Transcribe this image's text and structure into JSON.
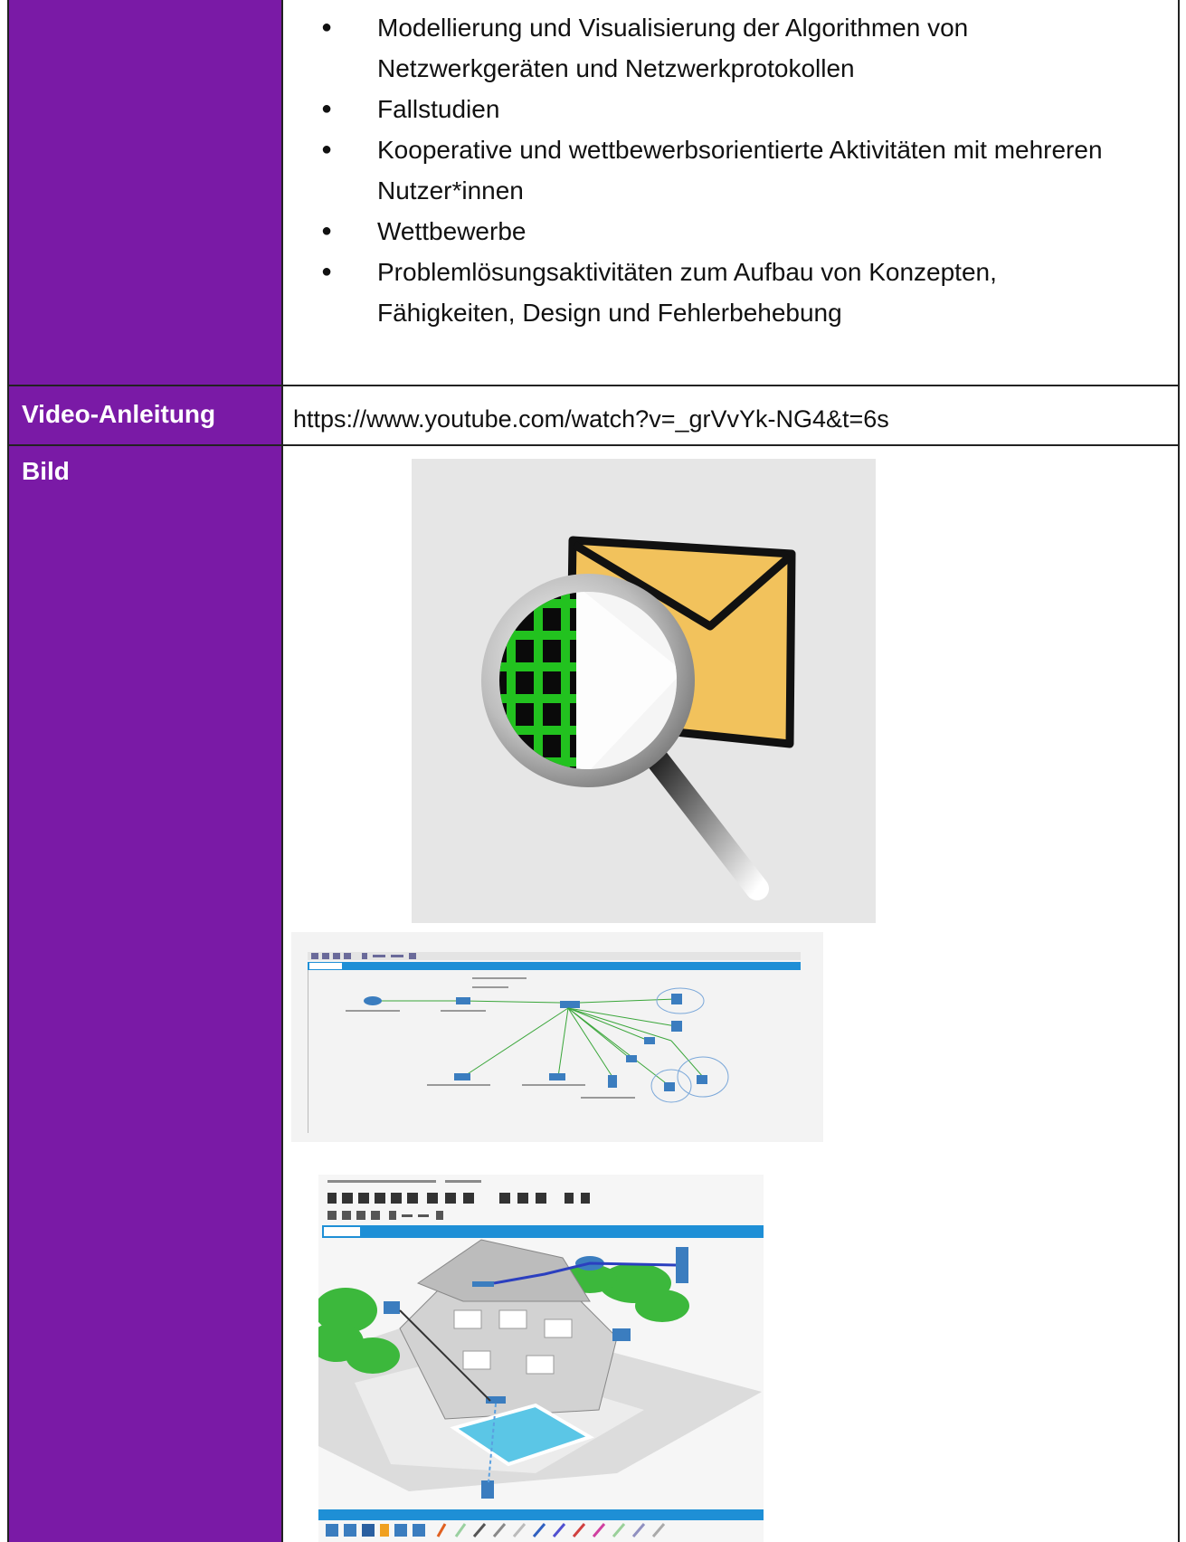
{
  "bullets": [
    "Modellierung und Visualisierung der Algorithmen von Netzwerkgeräten und Netzwerkprotokollen",
    "Fallstudien",
    "Kooperative und wettbewerbsorientierte Aktivitäten mit mehreren Nutzer*innen",
    "Wettbewerbe",
    "Problemlösungsaktivitäten zum Aufbau von Konzepten, Fähigkeiten, Design und Fehlerbehebung"
  ],
  "rows": {
    "video_label": "Video-Anleitung",
    "video_url": "https://www.youtube.com/watch?v=_grVvYk-NG4&t=6s",
    "image_label": "Bild"
  },
  "colors": {
    "label_bg": "#7a1aa6",
    "envelope": "#f2c25c",
    "grid_green": "#22c21f",
    "toolbar_blue": "#1e8fd6"
  },
  "icons": [
    "envelope-magnifier-icon"
  ]
}
